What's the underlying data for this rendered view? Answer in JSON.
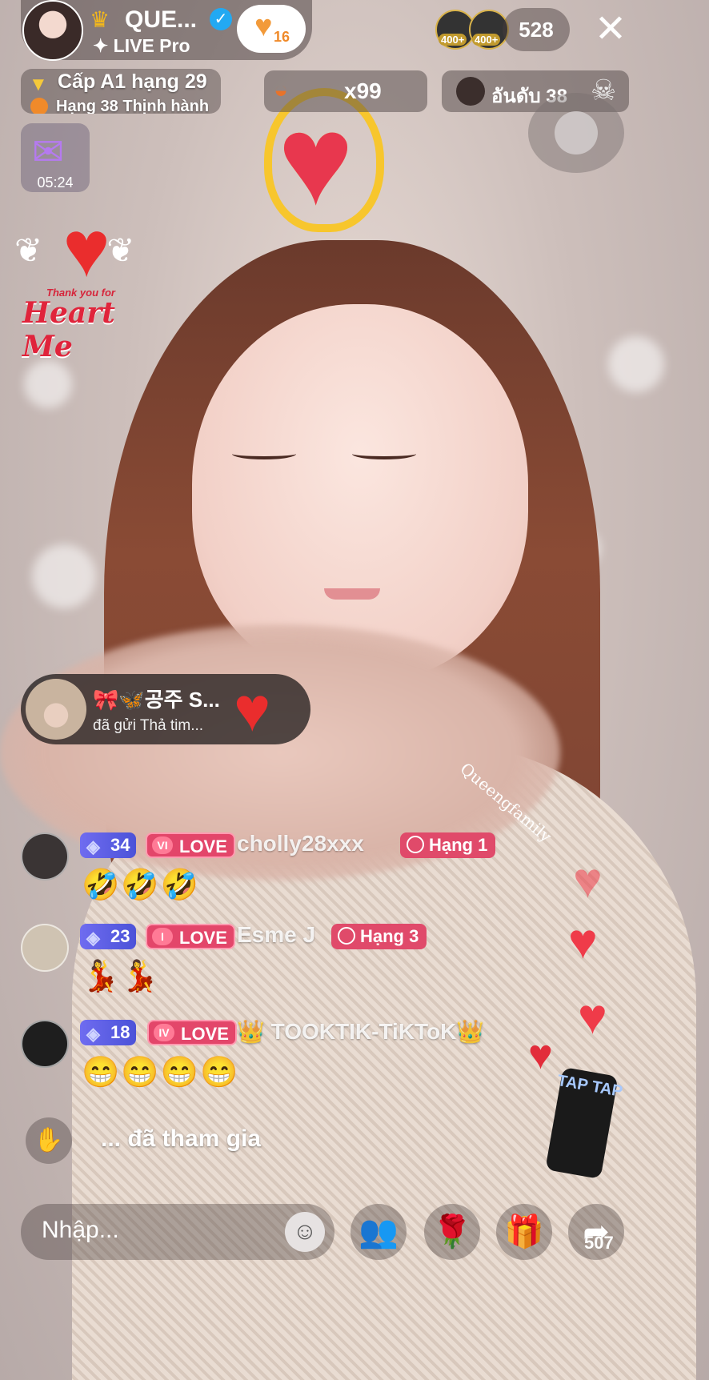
{
  "host": {
    "name": "QUE...",
    "subtitle": "✦ LIVE Pro",
    "follow_count": "16"
  },
  "viewers": {
    "badges": [
      "400+",
      "400+"
    ],
    "count": "528"
  },
  "ranking": {
    "level_text": "Cấp A1 hạng 29",
    "trend_text": "Hạng 38 Thịnh hành"
  },
  "hat_gift": {
    "count": "x99"
  },
  "rank_badge": {
    "text": "อันดับ 38"
  },
  "gift_box": {
    "timer": "05:24"
  },
  "heartme": {
    "subtitle": "Thank you for",
    "title": "Heart Me"
  },
  "gift_notice": {
    "sender": "🎀🦋공주 S...",
    "action": "đã gửi Thả tim..."
  },
  "watermark": "Queengfamily",
  "chat": [
    {
      "level": "34",
      "love_roman": "VI",
      "love_label": "LOVE",
      "user": "cholly28xxx",
      "hang": "Hạng 1",
      "message": "🤣🤣🤣"
    },
    {
      "level": "23",
      "love_roman": "I",
      "love_label": "LOVE",
      "user": "Esme J",
      "hang": "Hạng 3",
      "message": "💃💃"
    },
    {
      "level": "18",
      "love_roman": "IV",
      "love_label": "LOVE",
      "user": "👑 TOOKTIK-TiKToK👑",
      "hang": "",
      "message": "😁😁😁😁"
    }
  ],
  "join": {
    "text": "... đã tham gia"
  },
  "taptap": {
    "label": "TAP TAP"
  },
  "bottom": {
    "input_placeholder": "Nhập...",
    "share_count": "507"
  },
  "colors": {
    "accent": "#e3466a",
    "heart": "#ef3b49",
    "level_badge": "#5b5fe6",
    "gold": "#f5c93a"
  }
}
